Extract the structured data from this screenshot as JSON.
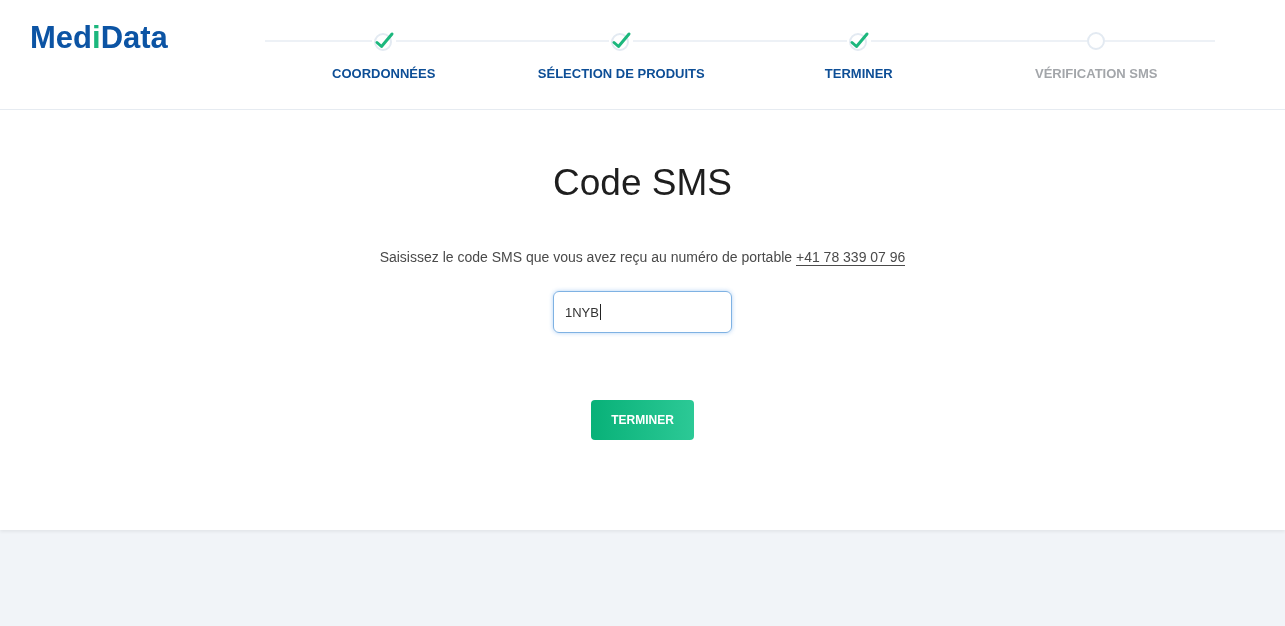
{
  "logo": {
    "parts": [
      {
        "text": "Med",
        "accent": false
      },
      {
        "text": "i",
        "accent": true
      },
      {
        "text": "Data",
        "accent": false
      }
    ]
  },
  "steps": [
    {
      "label": "COORDONNÉES",
      "completed": true
    },
    {
      "label": "SÉLECTION DE PRODUITS",
      "completed": true
    },
    {
      "label": "TERMINER",
      "completed": true
    },
    {
      "label": "VÉRIFICATION SMS",
      "completed": false
    }
  ],
  "title": "Code SMS",
  "instruction": {
    "text": "Saisissez le code SMS que vous avez reçu au numéro de portable",
    "phone_link": "+41 78 339 07 96"
  },
  "code_field": {
    "value": "1NYB",
    "focused": true
  },
  "submit_button": {
    "label": "TERMINER"
  }
}
